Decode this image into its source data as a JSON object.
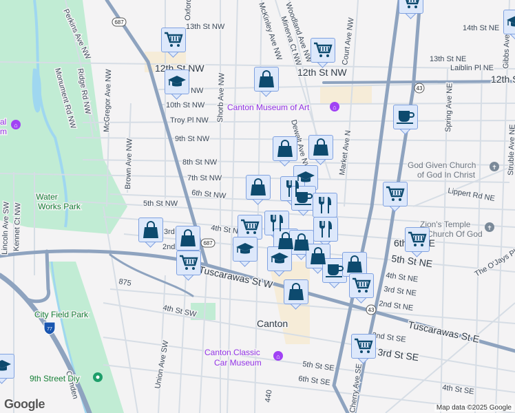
{
  "map": {
    "city_label": "Canton",
    "streets": {
      "perkins": "Perkins Ave NW",
      "ridge": "Ridge Rd NW",
      "mcgregor": "McGregor Ave NW",
      "monument": "Monument Rd NW",
      "brown": "Brown Ave NW",
      "shorb": "Shorb Ave NW",
      "mckinley": "McKinley Ave NW",
      "oxford": "Oxford",
      "st13nw": "13th St NW",
      "st12nw": "12th St NW",
      "st12nw_b": "12th St NW",
      "st11nw": "11th St NW",
      "st10nw": "10th St NW",
      "troy": "Troy Pl NW",
      "st9nw": "9th St NW",
      "st8nw": "8th St NW",
      "st7nw": "7th St NW",
      "st6nw": "6th St NW",
      "st5nw": "5th St NW",
      "st4nw": "4th St NW",
      "st3nw": "3rd",
      "st2nw": "2nd",
      "tusc_w": "Tuscarawas St W",
      "tusc_e": "Tuscarawas St E",
      "st4sw": "4th St SW",
      "union": "Union Ave SW",
      "market": "Market Ave N",
      "dewalt": "Dewalt Ave NW",
      "woodland": "Woodland Ave NW",
      "minerva": "Minerva Ct NW",
      "court": "Court Ave NW",
      "st14ne": "14th St NE",
      "st13ne": "13th St NE",
      "laiblin": "Laiblin Pl NE",
      "st12ne": "12th St NE",
      "spring": "Spring Ave NE",
      "gibbs": "Gibbs Ave NE",
      "struble": "Struble Ave NE",
      "lippert": "Lippert Rd NE",
      "st6ne": "6th St NE",
      "st5ne": "5th St NE",
      "st4ne": "4th St NE",
      "st3ne": "3rd St NE",
      "st2ne": "2nd St NE",
      "ojays": "The O'Jays Pkwy",
      "st2se": "2nd St SE",
      "st3se": "3rd St SE",
      "st4se": "4th St SE",
      "st5se": "5th St SE",
      "st6se": "6th St SE",
      "cherry": "Cherry Ave SE",
      "lincoln": "Lincoln Ave SW",
      "kennet": "Kennet Ct NW",
      "rt875": "875",
      "rt440": "440",
      "camden": "Camden"
    },
    "route_shields": {
      "r687": "687",
      "r43": "43",
      "i77": "77"
    },
    "places": {
      "museum_art": "Canton Museum of Art",
      "car_museum_1": "Canton Classic",
      "car_museum_2": "Car Museum",
      "water_works_1": "Water",
      "water_works_2": "Works Park",
      "city_field": "City Field Park",
      "ninth_diy": "9th Street Diy",
      "god_given_1": "God Given Church",
      "god_given_2": "of God In Christ",
      "zions_1": "Zion's Temple",
      "zions_2": "Church Of God",
      "left_museum_1": "al",
      "left_museum_2": "m"
    },
    "marker_types": [
      "shopping-cart",
      "shopping-bag",
      "graduation-cap",
      "coffee-cup",
      "fork-knife"
    ],
    "marker_color": "#0d4a6e",
    "attribution": "Map data ©2025 Google",
    "logo": "Google"
  }
}
